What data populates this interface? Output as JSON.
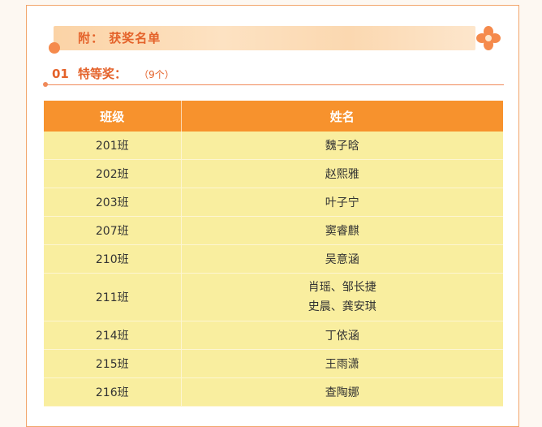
{
  "banner": {
    "title": "附：  获奖名单"
  },
  "section": {
    "number": "01",
    "label": "特等奖：",
    "count": "（9个）"
  },
  "table": {
    "headers": [
      "班级",
      "姓名"
    ],
    "rows": [
      {
        "class": "201班",
        "names": [
          "魏子晗"
        ]
      },
      {
        "class": "202班",
        "names": [
          "赵熙雅"
        ]
      },
      {
        "class": "203班",
        "names": [
          "叶子宁"
        ]
      },
      {
        "class": "207班",
        "names": [
          "窦睿麒"
        ]
      },
      {
        "class": "210班",
        "names": [
          "吴意涵"
        ]
      },
      {
        "class": "211班",
        "names": [
          "肖瑶、邹长捷",
          "史晨、龚安琪"
        ]
      },
      {
        "class": "214班",
        "names": [
          "丁依涵"
        ]
      },
      {
        "class": "215班",
        "names": [
          "王雨潇"
        ]
      },
      {
        "class": "216班",
        "names": [
          "查陶娜"
        ]
      }
    ]
  },
  "colors": {
    "accent": "#e4622a",
    "header_bg": "#f7922d",
    "row_bg": "#f9ee9f",
    "border": "#f2a56b"
  },
  "icons": {
    "decoration": "flower-icon"
  }
}
